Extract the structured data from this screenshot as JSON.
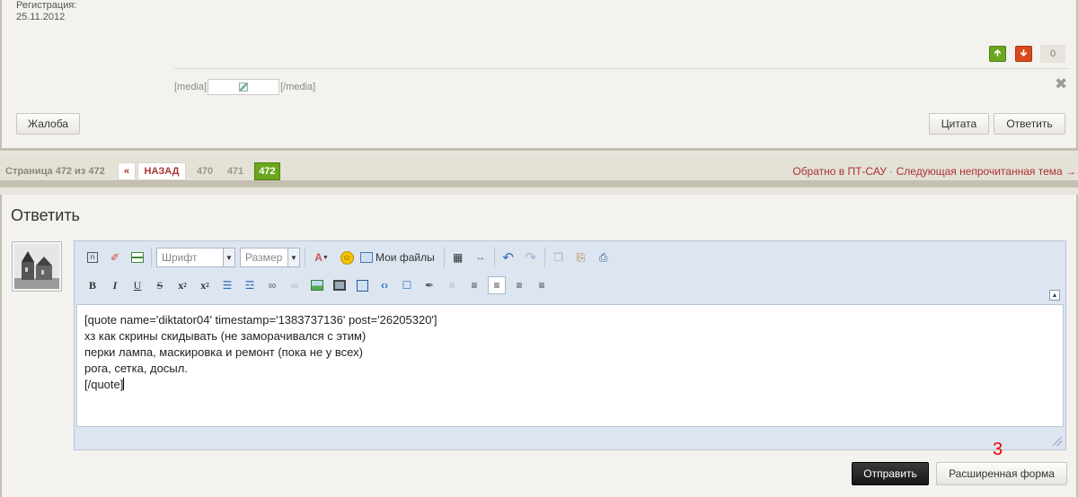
{
  "post": {
    "registration_label": "Регистрация:",
    "registration_date": "25.11.2012",
    "vote_count": "0",
    "media_open": "[media]",
    "media_close": "[/media]",
    "complaint_label": "Жалоба",
    "quote_label": "Цитата",
    "reply_label": "Ответить"
  },
  "pager": {
    "page_label": "Страница 472 из 472",
    "first_label": "«",
    "back_label": "НАЗАД",
    "pages": [
      "470",
      "471",
      "472"
    ],
    "current_page": "472",
    "link_back": "Обратно в ПТ-САУ",
    "link_sep": " · ",
    "link_next": "Следующая непрочитанная тема →"
  },
  "reply": {
    "title": "Ответить",
    "font_select": "Шрифт",
    "size_select": "Размер",
    "myfiles_label": "Мои файлы",
    "text_lines": [
      "[quote name='diktator04' timestamp='1383737136' post='26205320']",
      "хз как скрины скидывать (не заморачивался с этим)",
      "перки лампа, маскировка и ремонт (пока не у всех)",
      "рога, сетка, досыл.",
      "[/quote]"
    ],
    "annotation": "3",
    "send_label": "Отправить",
    "extended_label": "Расширенная форма"
  },
  "colors": {
    "accent_green": "#6aa61e",
    "accent_red": "#d84a1b",
    "link_red": "#aa3333"
  }
}
